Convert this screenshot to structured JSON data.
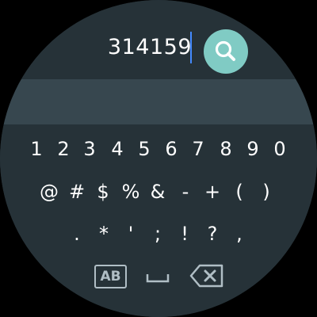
{
  "search": {
    "query": "314159",
    "button_icon": "search-icon"
  },
  "keyboard": {
    "row1": [
      "1",
      "2",
      "3",
      "4",
      "5",
      "6",
      "7",
      "8",
      "9",
      "0"
    ],
    "row2": [
      "@",
      "#",
      "$",
      "%",
      "&",
      "-",
      "+",
      "(",
      ")"
    ],
    "row3": [
      ".",
      "*",
      "'",
      ";",
      "!",
      "?",
      ","
    ],
    "mode_switch_label": "AB",
    "space_icon": "space-icon",
    "backspace_icon": "backspace-icon"
  },
  "colors": {
    "background": "#263238",
    "suggestion_strip": "#37474f",
    "accent": "#80cbc4",
    "cursor": "#448aff",
    "key_text": "#ffffff",
    "function_key": "#b0bec5"
  }
}
